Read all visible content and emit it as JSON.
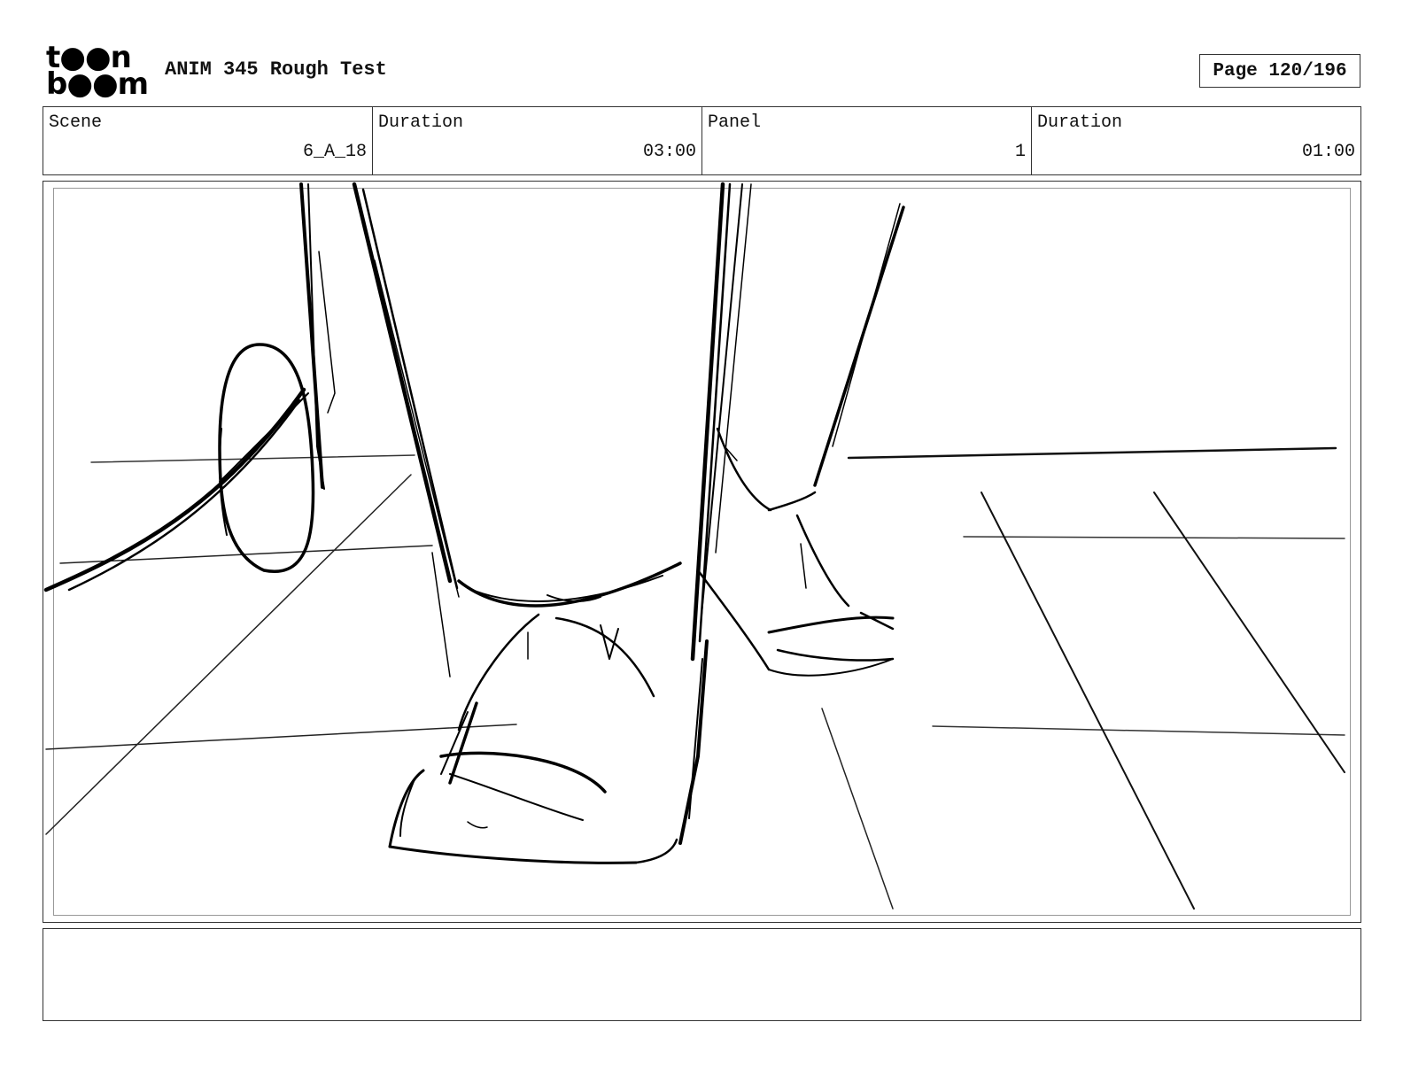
{
  "header": {
    "logo_line1": "t●●n",
    "logo_line2": "b●●m",
    "title": "ANIM 345 Rough Test",
    "page_label": "Page",
    "page_number": "120/196"
  },
  "info": {
    "scene_label": "Scene",
    "scene_value": "6_A_18",
    "scene_duration_label": "Duration",
    "scene_duration_value": "03:00",
    "panel_label": "Panel",
    "panel_value": "1",
    "panel_duration_label": "Duration",
    "panel_duration_value": "01:00"
  },
  "panel": {
    "stroke_color": "#000000",
    "floor_line_color": "#222222"
  },
  "notes": {
    "text": ""
  }
}
